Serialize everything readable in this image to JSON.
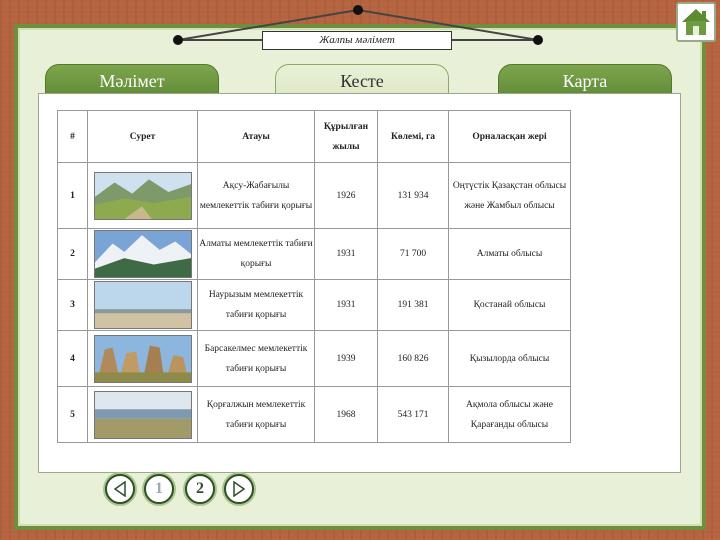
{
  "header": {
    "title": "Жалпы мәлімет"
  },
  "tabs": [
    {
      "label": "Мәлімет",
      "active": false
    },
    {
      "label": "Кесте",
      "active": true
    },
    {
      "label": "Карта",
      "active": false
    }
  ],
  "table": {
    "headers": [
      "#",
      "Сурет",
      "Атауы",
      "Құрылған жылы",
      "Көлемі, га",
      "Орналасқан жері"
    ],
    "rows": [
      {
        "num": "1",
        "name": "Ақсу-Жабағылы мемлекеттік табиғи қорығы",
        "year": "1926",
        "area": "131 934",
        "location": "Оңтүстік Қазақстан облысы және Жамбыл облысы",
        "photo": "mountain-valley"
      },
      {
        "num": "2",
        "name": "Алматы мемлекеттік табиғи қорығы",
        "year": "1931",
        "area": "71 700",
        "location": "Алматы облысы",
        "photo": "snowy-peaks"
      },
      {
        "num": "3",
        "name": "Наурызым мемлекеттік табиғи қорығы",
        "year": "1931",
        "area": "191 381",
        "location": "Қостанай облысы",
        "photo": "steppe"
      },
      {
        "num": "4",
        "name": "Барсакелмес мемлекеттік табиғи қорығы",
        "year": "1939",
        "area": "160 826",
        "location": "Қызылорда облысы",
        "photo": "rock-formations"
      },
      {
        "num": "5",
        "name": "Қорғалжын мемлекеттік табиғи қорығы",
        "year": "1968",
        "area": "543 171",
        "location": "Ақмола облысы және Қарағанды облысы",
        "photo": "lake"
      }
    ]
  },
  "pager": {
    "page1": "1",
    "page2": "2",
    "current": "2"
  },
  "colors": {
    "board": "#e8f1d7",
    "tab": "#6e9a40",
    "frame": "#b5643f"
  }
}
